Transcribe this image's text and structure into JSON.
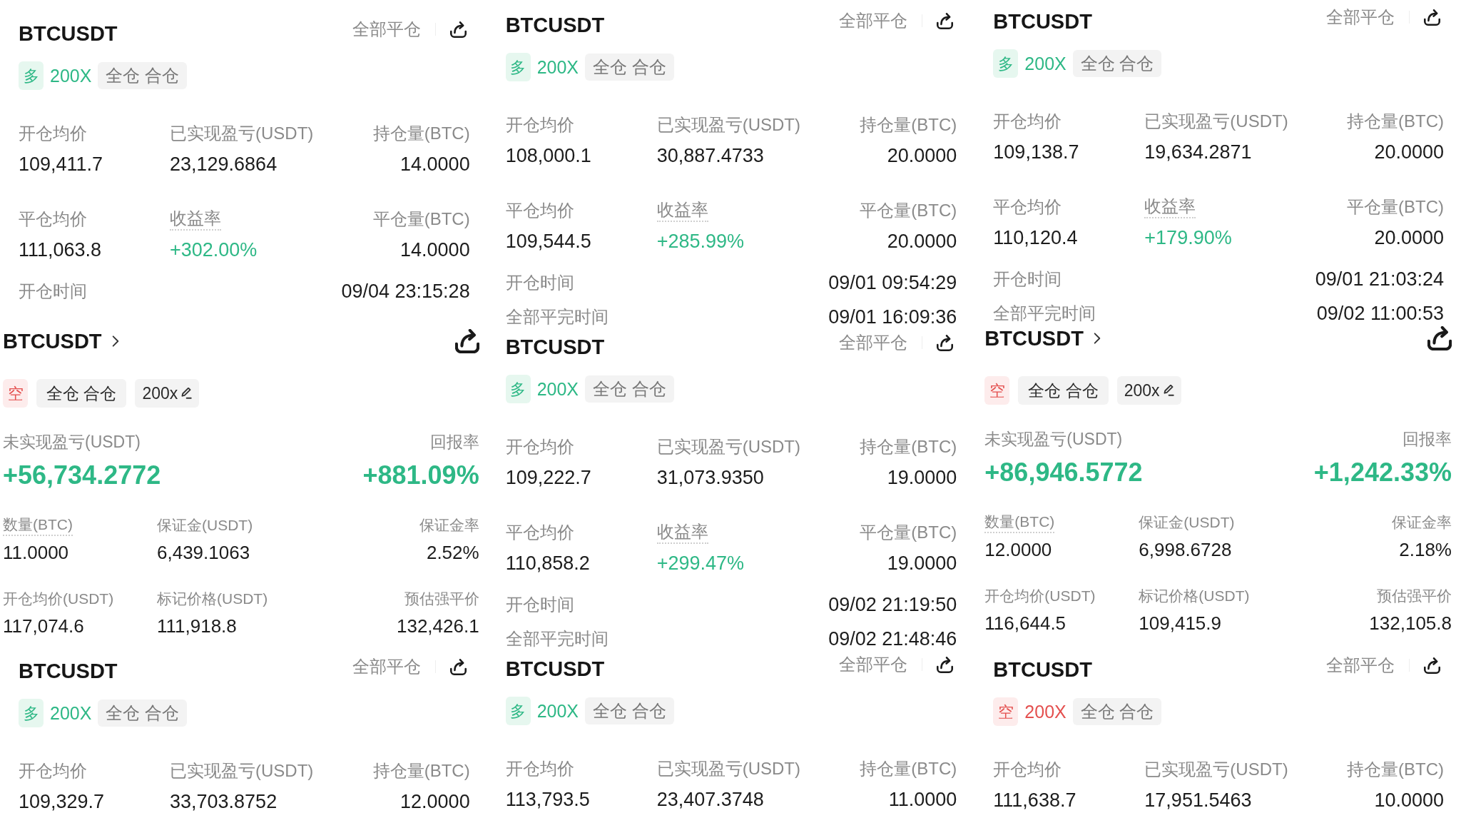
{
  "columns": [
    {
      "cards": [
        {
          "kind": "closed",
          "symbol": "BTCUSDT",
          "close_all": "全部平仓",
          "side": {
            "label": "多",
            "long": true
          },
          "leverage": "200X",
          "margin_mode": "全仓 合仓",
          "stats": [
            {
              "label": "开仓均价",
              "value": "109,411.7",
              "underlined": false,
              "gain": false
            },
            {
              "label": "已实现盈亏(USDT)",
              "value": "23,129.6864",
              "underlined": false,
              "gain": false
            },
            {
              "label": "持仓量(BTC)",
              "value": "14.0000",
              "underlined": false,
              "gain": false
            },
            {
              "label": "平仓均价",
              "value": "111,063.8",
              "underlined": false,
              "gain": false
            },
            {
              "label": "收益率",
              "value": "+302.00%",
              "underlined": true,
              "gain": true
            },
            {
              "label": "平仓量(BTC)",
              "value": "14.0000",
              "underlined": false,
              "gain": false
            }
          ],
          "times": [
            {
              "label": "开仓时间",
              "value": "09/04 23:15:28"
            }
          ]
        },
        {
          "kind": "open",
          "symbol": "BTCUSDT",
          "side": {
            "label": "空",
            "long": false
          },
          "margin_mode": "全仓 合仓",
          "leverage": "200x",
          "pnl": {
            "label": "未实现盈亏(USDT)",
            "value": "+56,734.2772",
            "gain": true
          },
          "roe": {
            "label": "回报率",
            "value": "+881.09%",
            "gain": true
          },
          "stats": [
            {
              "label": "数量(BTC)",
              "value": "11.0000",
              "underlined": true,
              "gain": false
            },
            {
              "label": "保证金(USDT)",
              "value": "6,439.1063",
              "underlined": false,
              "gain": false
            },
            {
              "label": "保证金率",
              "value": "2.52%",
              "underlined": false,
              "gain": false
            },
            {
              "label": "开仓均价(USDT)",
              "value": "117,074.6",
              "underlined": false,
              "gain": false
            },
            {
              "label": "标记价格(USDT)",
              "value": "111,918.8",
              "underlined": false,
              "gain": false
            },
            {
              "label": "预估强平价",
              "value": "132,426.1",
              "underlined": false,
              "gain": false
            }
          ]
        },
        {
          "kind": "closed",
          "symbol": "BTCUSDT",
          "close_all": "全部平仓",
          "side": {
            "label": "多",
            "long": true
          },
          "leverage": "200X",
          "margin_mode": "全仓 合仓",
          "stats": [
            {
              "label": "开仓均价",
              "value": "109,329.7",
              "underlined": false,
              "gain": false
            },
            {
              "label": "已实现盈亏(USDT)",
              "value": "33,703.8752",
              "underlined": false,
              "gain": false
            },
            {
              "label": "持仓量(BTC)",
              "value": "12.0000",
              "underlined": false,
              "gain": false
            }
          ]
        }
      ]
    },
    {
      "cards": [
        {
          "kind": "closed",
          "symbol": "BTCUSDT",
          "close_all": "全部平仓",
          "side": {
            "label": "多",
            "long": true
          },
          "leverage": "200X",
          "margin_mode": "全仓 合仓",
          "stats": [
            {
              "label": "开仓均价",
              "value": "108,000.1",
              "underlined": false,
              "gain": false
            },
            {
              "label": "已实现盈亏(USDT)",
              "value": "30,887.4733",
              "underlined": false,
              "gain": false
            },
            {
              "label": "持仓量(BTC)",
              "value": "20.0000",
              "underlined": false,
              "gain": false
            },
            {
              "label": "平仓均价",
              "value": "109,544.5",
              "underlined": false,
              "gain": false
            },
            {
              "label": "收益率",
              "value": "+285.99%",
              "underlined": true,
              "gain": true
            },
            {
              "label": "平仓量(BTC)",
              "value": "20.0000",
              "underlined": false,
              "gain": false
            }
          ],
          "times": [
            {
              "label": "开仓时间",
              "value": "09/01 09:54:29"
            },
            {
              "label": "全部平完时间",
              "value": "09/01 16:09:36"
            }
          ]
        },
        {
          "kind": "closed",
          "symbol": "BTCUSDT",
          "close_all": "全部平仓",
          "side": {
            "label": "多",
            "long": true
          },
          "leverage": "200X",
          "margin_mode": "全仓 合仓",
          "stats": [
            {
              "label": "开仓均价",
              "value": "109,222.7",
              "underlined": false,
              "gain": false
            },
            {
              "label": "已实现盈亏(USDT)",
              "value": "31,073.9350",
              "underlined": false,
              "gain": false
            },
            {
              "label": "持仓量(BTC)",
              "value": "19.0000",
              "underlined": false,
              "gain": false
            },
            {
              "label": "平仓均价",
              "value": "110,858.2",
              "underlined": false,
              "gain": false
            },
            {
              "label": "收益率",
              "value": "+299.47%",
              "underlined": true,
              "gain": true
            },
            {
              "label": "平仓量(BTC)",
              "value": "19.0000",
              "underlined": false,
              "gain": false
            }
          ],
          "times": [
            {
              "label": "开仓时间",
              "value": "09/02 21:19:50"
            },
            {
              "label": "全部平完时间",
              "value": "09/02 21:48:46"
            }
          ]
        },
        {
          "kind": "closed",
          "symbol": "BTCUSDT",
          "close_all": "全部平仓",
          "side": {
            "label": "多",
            "long": true
          },
          "leverage": "200X",
          "margin_mode": "全仓 合仓",
          "stats": [
            {
              "label": "开仓均价",
              "value": "113,793.5",
              "underlined": false,
              "gain": false
            },
            {
              "label": "已实现盈亏(USDT)",
              "value": "23,407.3748",
              "underlined": false,
              "gain": false
            },
            {
              "label": "持仓量(BTC)",
              "value": "11.0000",
              "underlined": false,
              "gain": false
            }
          ]
        }
      ]
    },
    {
      "cards": [
        {
          "kind": "closed",
          "symbol": "BTCUSDT",
          "close_all": "全部平仓",
          "side": {
            "label": "多",
            "long": true
          },
          "leverage": "200X",
          "margin_mode": "全仓 合仓",
          "stats": [
            {
              "label": "开仓均价",
              "value": "109,138.7",
              "underlined": false,
              "gain": false
            },
            {
              "label": "已实现盈亏(USDT)",
              "value": "19,634.2871",
              "underlined": false,
              "gain": false
            },
            {
              "label": "持仓量(BTC)",
              "value": "20.0000",
              "underlined": false,
              "gain": false
            },
            {
              "label": "平仓均价",
              "value": "110,120.4",
              "underlined": false,
              "gain": false
            },
            {
              "label": "收益率",
              "value": "+179.90%",
              "underlined": true,
              "gain": true
            },
            {
              "label": "平仓量(BTC)",
              "value": "20.0000",
              "underlined": false,
              "gain": false
            }
          ],
          "times": [
            {
              "label": "开仓时间",
              "value": "09/01 21:03:24"
            },
            {
              "label": "全部平完时间",
              "value": "09/02 11:00:53"
            }
          ]
        },
        {
          "kind": "open",
          "symbol": "BTCUSDT",
          "side": {
            "label": "空",
            "long": false
          },
          "margin_mode": "全仓 合仓",
          "leverage": "200x",
          "pnl": {
            "label": "未实现盈亏(USDT)",
            "value": "+86,946.5772",
            "gain": true
          },
          "roe": {
            "label": "回报率",
            "value": "+1,242.33%",
            "gain": true
          },
          "stats": [
            {
              "label": "数量(BTC)",
              "value": "12.0000",
              "underlined": true,
              "gain": false
            },
            {
              "label": "保证金(USDT)",
              "value": "6,998.6728",
              "underlined": false,
              "gain": false
            },
            {
              "label": "保证金率",
              "value": "2.18%",
              "underlined": false,
              "gain": false
            },
            {
              "label": "开仓均价(USDT)",
              "value": "116,644.5",
              "underlined": false,
              "gain": false
            },
            {
              "label": "标记价格(USDT)",
              "value": "109,415.9",
              "underlined": false,
              "gain": false
            },
            {
              "label": "预估强平价",
              "value": "132,105.8",
              "underlined": false,
              "gain": false
            }
          ]
        },
        {
          "kind": "closed",
          "symbol": "BTCUSDT",
          "close_all": "全部平仓",
          "side": {
            "label": "空",
            "long": false
          },
          "leverage": "200X",
          "margin_mode": "全仓 合仓",
          "stats": [
            {
              "label": "开仓均价",
              "value": "111,638.7",
              "underlined": false,
              "gain": false
            },
            {
              "label": "已实现盈亏(USDT)",
              "value": "17,951.5463",
              "underlined": false,
              "gain": false
            },
            {
              "label": "持仓量(BTC)",
              "value": "10.0000",
              "underlined": false,
              "gain": false
            }
          ]
        }
      ]
    }
  ]
}
